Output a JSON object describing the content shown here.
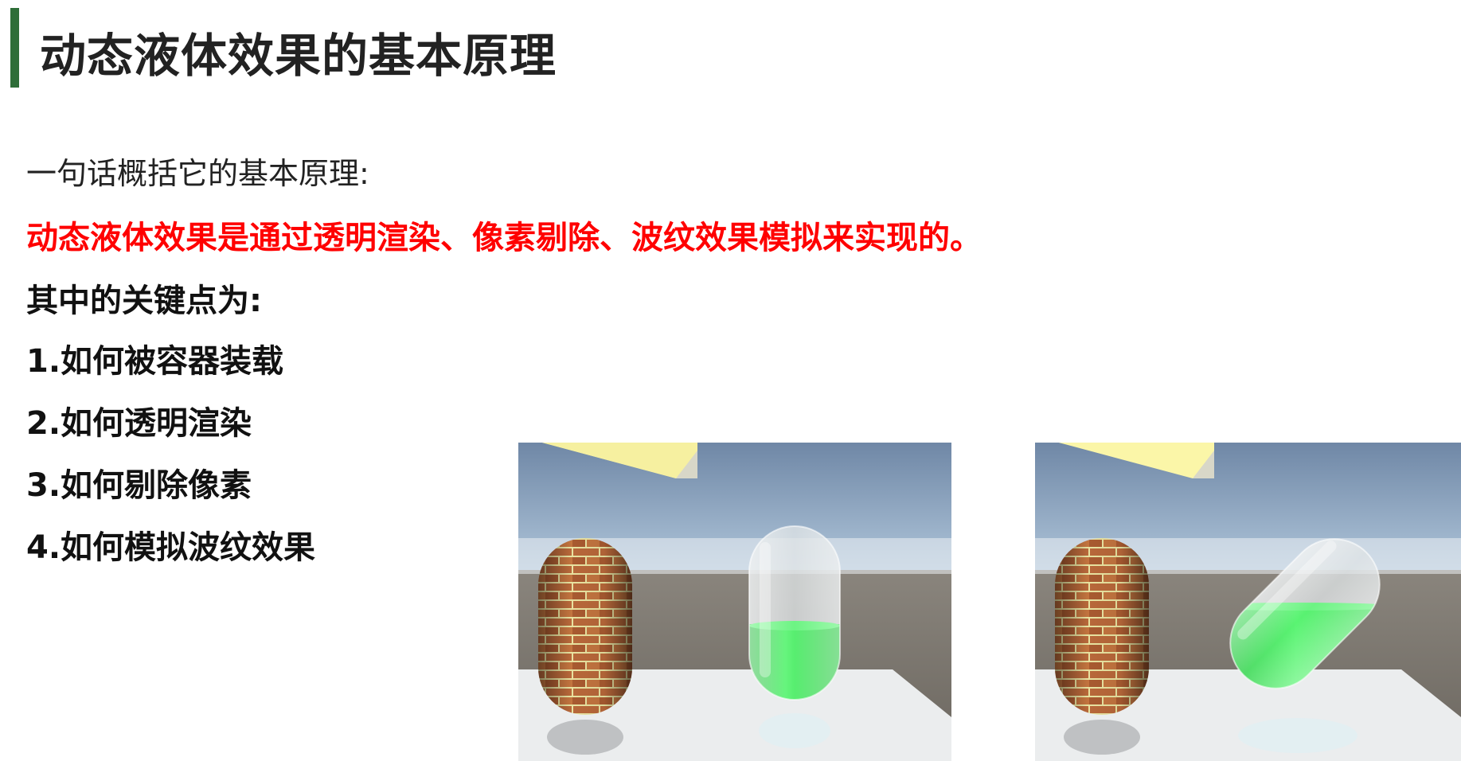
{
  "slide": {
    "title": "动态液体效果的基本原理",
    "intro": "一句话概括它的基本原理:",
    "highlight": "动态液体效果是通过透明渲染、像素剔除、波纹效果模拟来实现的。",
    "key_heading": "其中的关键点为:",
    "key_points": [
      "1.如何被容器装载",
      "2.如何透明渲染",
      "3.如何剔除像素",
      "4.如何模拟波纹效果"
    ]
  },
  "scenes": [
    {
      "liquid_state": "upright",
      "liquid_fill": 0.37
    },
    {
      "liquid_state": "tilted",
      "liquid_fill": 0.37
    }
  ],
  "colors": {
    "accent_bar": "#2e6e38",
    "highlight_text": "#ff0000",
    "liquid": "#19e83a",
    "brick": "#b8683a",
    "mortar": "#e8e2a0"
  }
}
